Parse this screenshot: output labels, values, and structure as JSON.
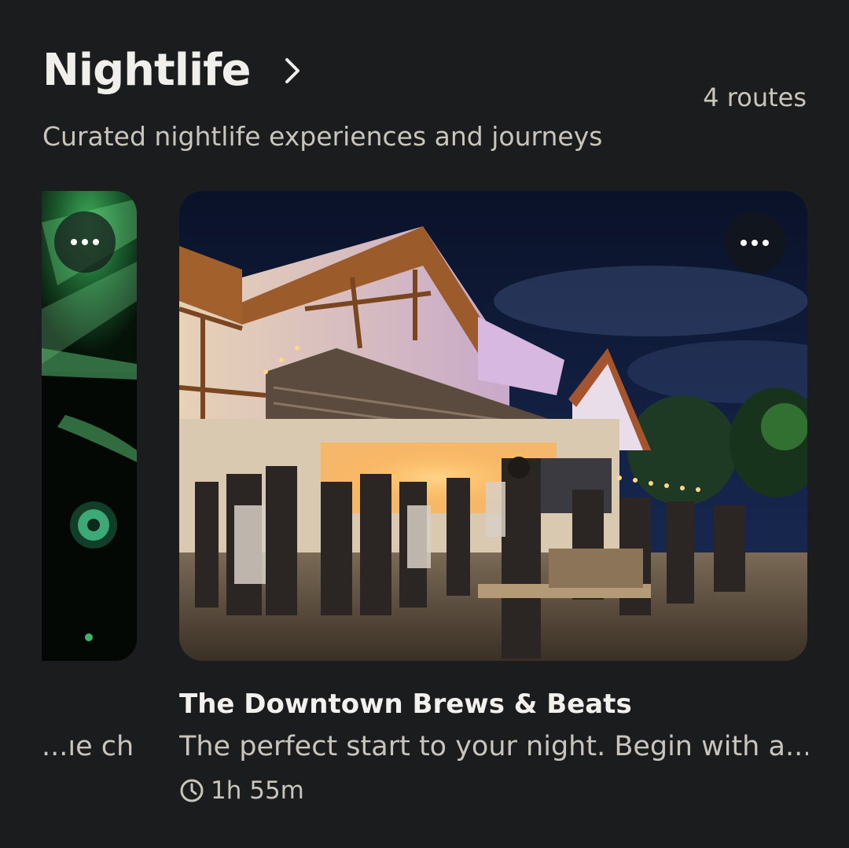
{
  "section": {
    "title": "Nightlife",
    "subtitle": "Curated nightlife experiences and journeys",
    "count": "4 routes"
  },
  "cards": [
    {
      "description": "ıe ch..."
    },
    {
      "title": "The Downtown Brews & Beats",
      "description": "The perfect start to your night. Begin with a...",
      "duration": "1h 55m"
    }
  ],
  "icons": {
    "chevron": "chevron-right-icon",
    "more": "more-horizontal-icon",
    "clock": "clock-icon"
  },
  "colors": {
    "background": "#1b1c1e",
    "primary_text": "#f1efeb",
    "secondary_text": "#c9c4bc"
  }
}
